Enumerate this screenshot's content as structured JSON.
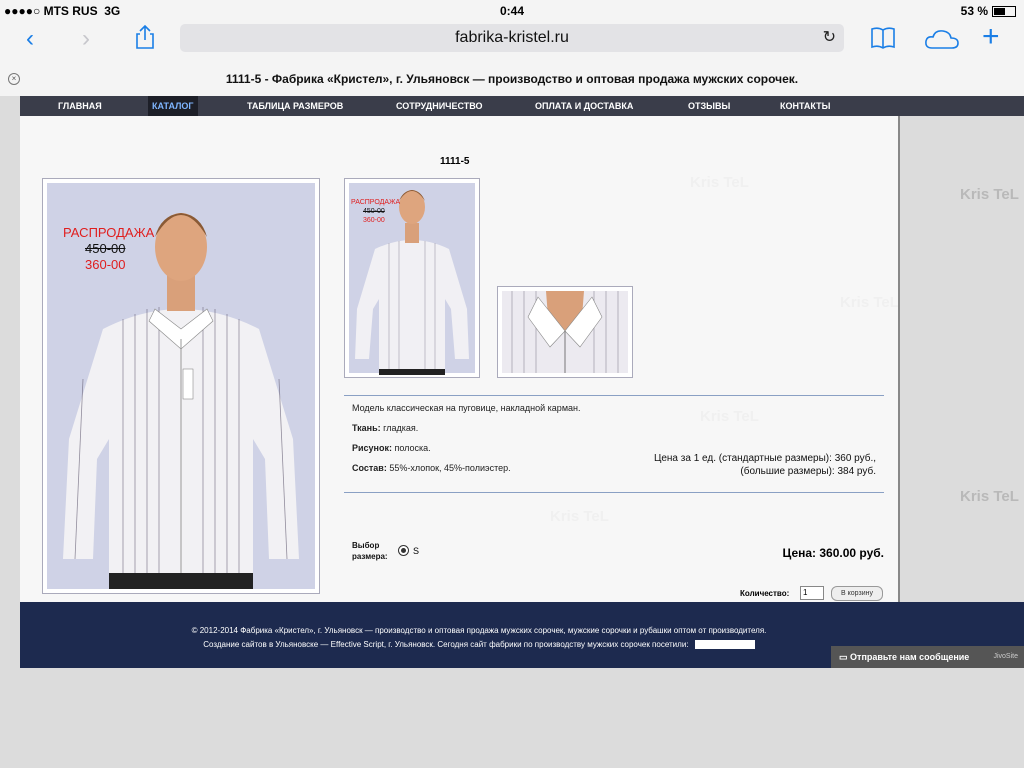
{
  "status_bar": {
    "carrier": "●●●●○ MTS RUS",
    "network": "3G",
    "time": "0:44",
    "battery": "53 %"
  },
  "browser": {
    "url": "fabrika-kristel.ru",
    "page_title": "1111-5 - Фабрика «Кристел», г. Ульяновск — производство и оптовая продажа мужских сорочек."
  },
  "nav": {
    "items": [
      {
        "label": "ГЛАВНАЯ"
      },
      {
        "label": "КАТАЛОГ"
      },
      {
        "label": "ТАБЛИЦА РАЗМЕРОВ"
      },
      {
        "label": "СОТРУДНИЧЕСТВО"
      },
      {
        "label": "ОПЛАТА И ДОСТАВКА"
      },
      {
        "label": "ОТЗЫВЫ"
      },
      {
        "label": "КОНТАКТЫ"
      }
    ]
  },
  "product": {
    "sku": "1111-5",
    "sale_label": "РАСПРОДАЖА",
    "old_price": "450-00",
    "new_price": "360-00",
    "description": "Модель классическая на пуговице, накладной карман.",
    "fabric_label": "Ткань:",
    "fabric": "гладкая.",
    "pattern_label": "Рисунок:",
    "pattern": "полоска.",
    "composition_label": "Состав:",
    "composition": "55%-хлопок, 45%-полиэстер.",
    "price_std": "Цена за 1 ед. (стандартные размеры): 360 руб.,",
    "price_big": "(большие размеры): 384 руб.",
    "size_label_1": "Выбор",
    "size_label_2": "размера:",
    "size_value": "S",
    "price_total": "Цена: 360.00 руб.",
    "qty_label": "Количество:",
    "qty_value": "1",
    "cart_button": "В корзину"
  },
  "watermark_text": "Kris TeL",
  "footer": {
    "line1": "© 2012-2014 Фабрика «Кристел», г. Ульяновск — производство и оптовая продажа мужских сорочек, мужские сорочки и рубашки оптом от производителя.",
    "line2": "Создание сайтов в Ульяновске — Effective Script, г. Ульяновск. Сегодня сайт фабрики по производству мужских сорочек посетили:"
  },
  "chat": {
    "label": "Отправьте нам сообщение",
    "brand": "JivoSite"
  }
}
